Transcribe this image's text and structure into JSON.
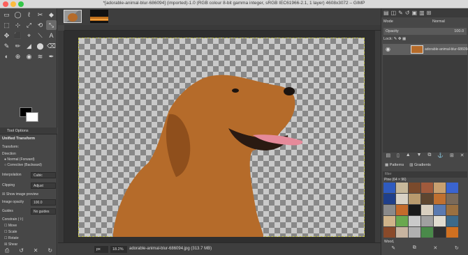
{
  "window": {
    "title": "*[adorable-animal-blur-686094] (imported)-1.0 (RGB colour 8-bit gamma integer, sRGB IEC61966-2.1, 1 layer) 4608x3072 – GIMP"
  },
  "toolbox": {
    "tools": [
      "▭",
      "◯",
      "ℓ",
      "✂",
      "◆",
      "⬚",
      "⊹",
      "⤢",
      "⟲",
      "⤡",
      "✥",
      "⬛",
      "⌖",
      "⟍",
      "A",
      "✎",
      "✏",
      "◢",
      "⬤",
      "⌫",
      "◐",
      "⊕",
      "◉",
      "≋",
      "✒"
    ],
    "options_tab": "Tool Options",
    "options_title": "Unified Transform",
    "transform_label": "Transform:",
    "direction_label": "Direction",
    "direction_normal": "Normal (Forward)",
    "direction_corrective": "Corrective (Backward)",
    "interpolation_label": "Interpolation",
    "interpolation_value": "Cubic",
    "clipping_label": "Clipping",
    "clipping_value": "Adjust",
    "show_preview": "Show image preview",
    "image_opacity_label": "Image opacity",
    "image_opacity_value": "100.0",
    "guides_label": "Guides",
    "guides_value": "No guides",
    "constrain_label": "Constrain (⇧)",
    "move": "Move",
    "scale": "Scale",
    "rotate": "Rotate",
    "shear": "Shear",
    "bottom_icons": [
      "⎙",
      "↺",
      "✕",
      "↻"
    ]
  },
  "canvas": {
    "colors": {
      "checker_dark": "#888888",
      "checker_light": "#c9c9c9",
      "boundary": "#c8c84a",
      "fur": "#b56b2a"
    }
  },
  "status": {
    "unit": "px",
    "zoom": "18.2%",
    "file": "adorable-animal-blur-686094.jpg (313.7 MB)"
  },
  "dock": {
    "mode_label": "Mode",
    "mode_value": "Normal",
    "opacity_label": "Opacity",
    "opacity_value": "100.0",
    "lock_label": "Lock:",
    "layer_name": "adorable-animal-blur-686094",
    "layer_buttons": [
      "▤",
      "▯",
      "▲",
      "▼",
      "⧉",
      "⚓",
      "⊞",
      "✕"
    ],
    "patterns_tab": "Patterns",
    "gradients_tab": "Gradients",
    "filter_placeholder": "filter",
    "pattern_size_label": "Pine (64 × 96)",
    "pattern_name": "Wood,",
    "pattern_buttons": [
      "✎",
      "⧉",
      "✕",
      "↻"
    ],
    "pattern_colors": [
      "#2f5bbf",
      "#c7b89a",
      "#7a4a2c",
      "#a05a3c",
      "#c8a070",
      "#3a64d0",
      "#1f3f8a",
      "#d9d2c6",
      "#b89a6e",
      "#5e4630",
      "#c07030",
      "#7a6a5a",
      "#8a8a8a",
      "#c46b2b",
      "#1a1a1a",
      "#d8cfc0",
      "#5a7ab0",
      "#9a7040",
      "#d0b48a",
      "#6aa84f",
      "#c9c9c9",
      "#a0a0a0",
      "#e0dcd0",
      "#3c6a8a",
      "#8a4a2a",
      "#c8b4a0",
      "#b0b0b0",
      "#4a8a4a",
      "#303030",
      "#d07020"
    ]
  }
}
